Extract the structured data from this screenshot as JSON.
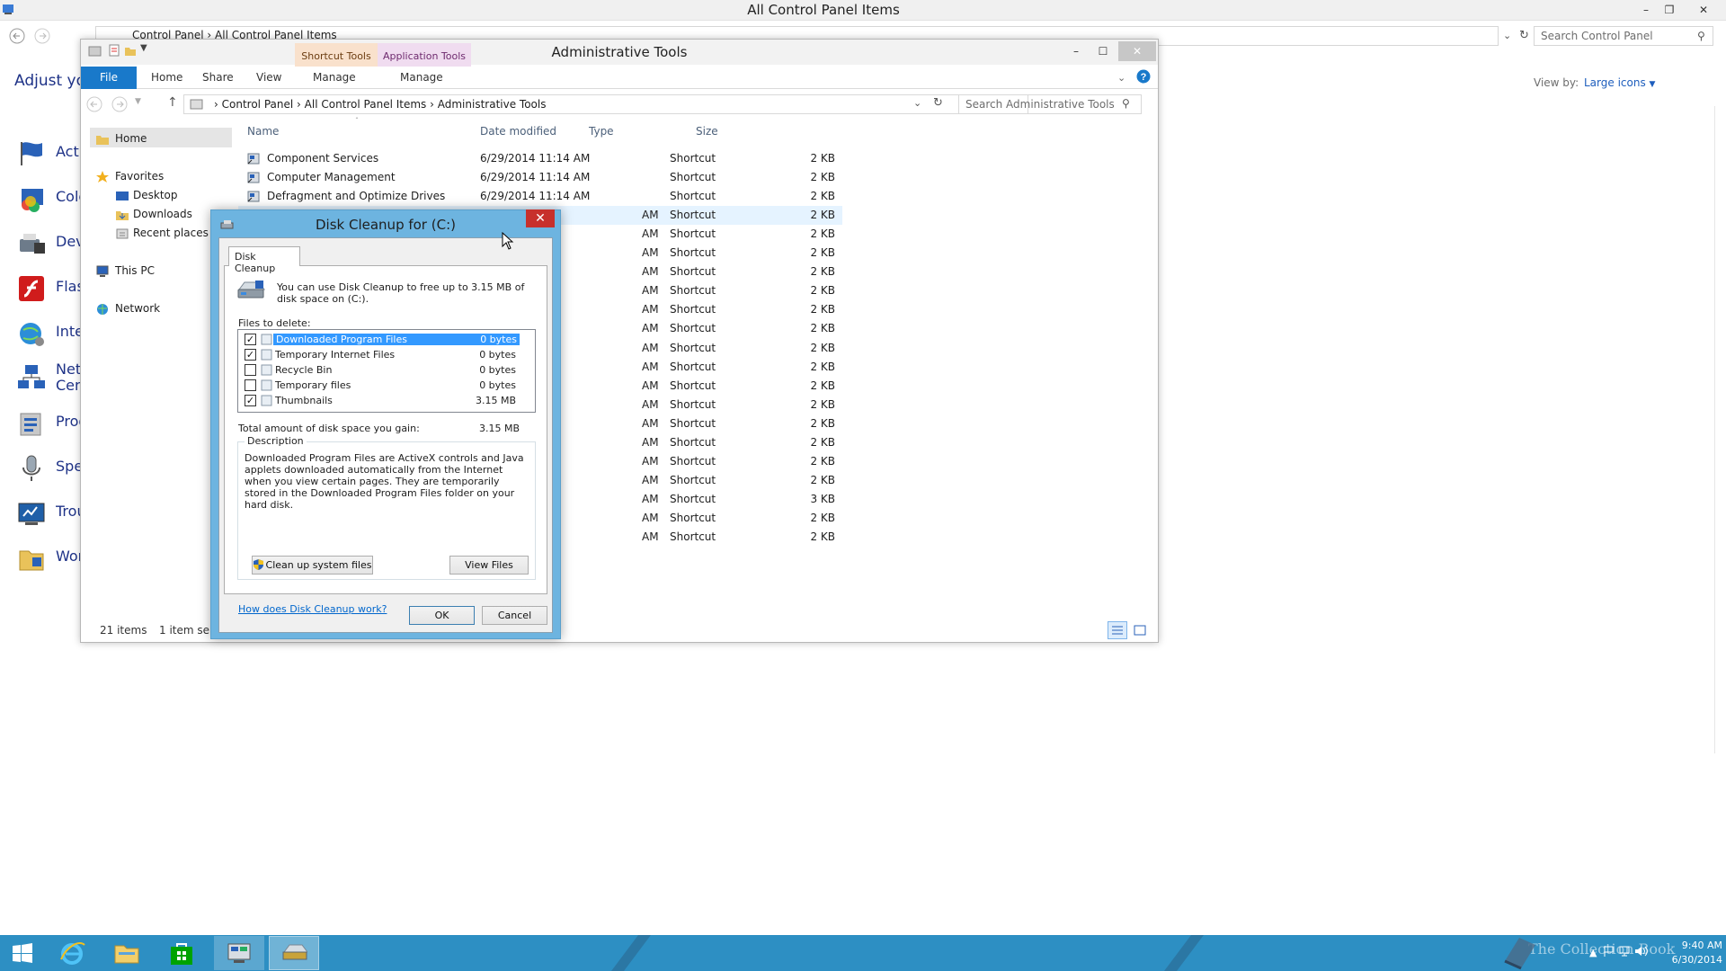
{
  "control_panel": {
    "window_title": "All Control Panel Items",
    "address_crumbs": [
      "Control Panel",
      "All Control Panel Items"
    ],
    "search_placeholder": "Search Control Panel",
    "adjust_heading": "Adjust you",
    "view_by_label": "View by:",
    "view_by_value": "Large icons",
    "items": [
      {
        "label": "Acti",
        "icon": "action-center-flag-icon"
      },
      {
        "label": "Colc",
        "icon": "color-management-icon"
      },
      {
        "label": "Dev",
        "icon": "devices-printers-icon"
      },
      {
        "label": "Flas",
        "icon": "flash-player-icon"
      },
      {
        "label": "Inte",
        "icon": "internet-options-icon"
      },
      {
        "label": "Netv\nCen",
        "icon": "network-center-icon"
      },
      {
        "label": "Prog",
        "icon": "programs-features-icon"
      },
      {
        "label": "Spe",
        "icon": "speech-recognition-icon"
      },
      {
        "label": "Trou",
        "icon": "troubleshooting-icon"
      },
      {
        "label": "Wor",
        "icon": "work-folders-icon"
      }
    ]
  },
  "explorer": {
    "title": "Administrative Tools",
    "context_tabs": {
      "shortcut": "Shortcut Tools",
      "application": "Application Tools"
    },
    "ribbon_tabs": {
      "file": "File",
      "home": "Home",
      "share": "Share",
      "view": "View",
      "manage1": "Manage",
      "manage2": "Manage"
    },
    "address_crumbs": [
      "Control Panel",
      "All Control Panel Items",
      "Administrative Tools"
    ],
    "search_placeholder": "Search Administrative Tools",
    "nav": {
      "home": "Home",
      "favorites": "Favorites",
      "desktop": "Desktop",
      "downloads": "Downloads",
      "recent": "Recent places",
      "this_pc": "This PC",
      "network": "Network"
    },
    "columns": {
      "name": "Name",
      "date": "Date modified",
      "type": "Type",
      "size": "Size"
    },
    "files": [
      {
        "name": "Component Services",
        "date": "6/29/2014 11:14 AM",
        "type": "Shortcut",
        "size": "2 KB"
      },
      {
        "name": "Computer Management",
        "date": "6/29/2014 11:14 AM",
        "type": "Shortcut",
        "size": "2 KB"
      },
      {
        "name": "Defragment and Optimize Drives",
        "date": "6/29/2014 11:14 AM",
        "type": "Shortcut",
        "size": "2 KB"
      },
      {
        "name": "",
        "date": "AM",
        "type": "Shortcut",
        "size": "2 KB"
      },
      {
        "name": "",
        "date": "AM",
        "type": "Shortcut",
        "size": "2 KB"
      },
      {
        "name": "",
        "date": "AM",
        "type": "Shortcut",
        "size": "2 KB"
      },
      {
        "name": "",
        "date": "AM",
        "type": "Shortcut",
        "size": "2 KB"
      },
      {
        "name": "",
        "date": "AM",
        "type": "Shortcut",
        "size": "2 KB"
      },
      {
        "name": "",
        "date": "AM",
        "type": "Shortcut",
        "size": "2 KB"
      },
      {
        "name": "",
        "date": "AM",
        "type": "Shortcut",
        "size": "2 KB"
      },
      {
        "name": "",
        "date": "AM",
        "type": "Shortcut",
        "size": "2 KB"
      },
      {
        "name": "",
        "date": "AM",
        "type": "Shortcut",
        "size": "2 KB"
      },
      {
        "name": "",
        "date": "AM",
        "type": "Shortcut",
        "size": "2 KB"
      },
      {
        "name": "",
        "date": "AM",
        "type": "Shortcut",
        "size": "2 KB"
      },
      {
        "name": "",
        "date": "AM",
        "type": "Shortcut",
        "size": "2 KB"
      },
      {
        "name": "",
        "date": "AM",
        "type": "Shortcut",
        "size": "2 KB"
      },
      {
        "name": "",
        "date": "AM",
        "type": "Shortcut",
        "size": "2 KB"
      },
      {
        "name": "",
        "date": "AM",
        "type": "Shortcut",
        "size": "2 KB"
      },
      {
        "name": "",
        "date": "AM",
        "type": "Shortcut",
        "size": "3 KB"
      },
      {
        "name": "",
        "date": "AM",
        "type": "Shortcut",
        "size": "2 KB"
      },
      {
        "name": "",
        "date": "AM",
        "type": "Shortcut",
        "size": "2 KB"
      }
    ],
    "status": {
      "items": "21 items",
      "selected": "1 item sele"
    }
  },
  "dialog": {
    "title": "Disk Cleanup for  (C:)",
    "tab": "Disk Cleanup",
    "intro": "You can use Disk Cleanup to free up to 3.15 MB of disk space on  (C:).",
    "files_label": "Files to delete:",
    "files": [
      {
        "name": "Downloaded Program Files",
        "size": "0 bytes",
        "checked": true
      },
      {
        "name": "Temporary Internet Files",
        "size": "0 bytes",
        "checked": true
      },
      {
        "name": "Recycle Bin",
        "size": "0 bytes",
        "checked": false
      },
      {
        "name": "Temporary files",
        "size": "0 bytes",
        "checked": false
      },
      {
        "name": "Thumbnails",
        "size": "3.15 MB",
        "checked": true
      }
    ],
    "total_label": "Total amount of disk space you gain:",
    "total_value": "3.15 MB",
    "description_legend": "Description",
    "description": "Downloaded Program Files are ActiveX controls and Java applets downloaded automatically from the Internet when you view certain pages. They are temporarily stored in the Downloaded Program Files folder on your hard disk.",
    "cleanup_system_label": "Clean up system files",
    "view_files_label": "View Files",
    "help_link": "How does Disk Cleanup work?",
    "ok_label": "OK",
    "cancel_label": "Cancel"
  },
  "taskbar": {
    "time": "9:40 AM",
    "date": "6/30/2014",
    "watermark": "The Collection Book"
  },
  "colors": {
    "accent": "#1979ca",
    "taskbar": "#2d8fc3",
    "dialog_frame": "#6db4e0",
    "close": "#c7302c",
    "selection": "#3399ff"
  }
}
